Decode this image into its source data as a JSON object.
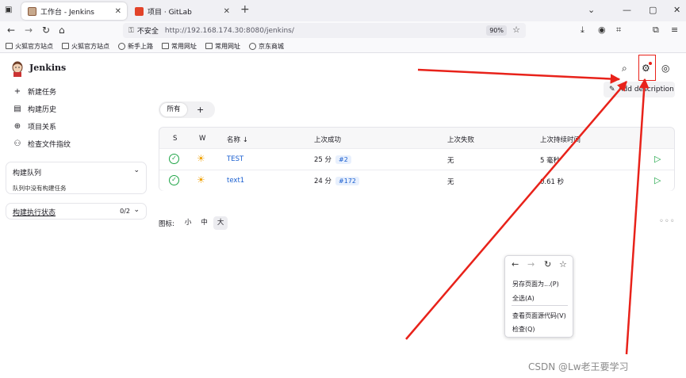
{
  "browser": {
    "tabs": [
      {
        "title": "工作台 - Jenkins",
        "active": true
      },
      {
        "title": "项目 · GitLab",
        "active": false
      }
    ],
    "url_security": "不安全",
    "url": "http://192.168.174.30:8080/jenkins/",
    "zoom": "90%",
    "bookmarks": [
      "火狐官方站点",
      "火狐官方站点",
      "新手上路",
      "常用网址",
      "常用网址",
      "京东商城"
    ]
  },
  "jenkins": {
    "brand": "Jenkins",
    "sidebar": {
      "items": [
        {
          "label": "新建任务",
          "icon": "plus-icon"
        },
        {
          "label": "构建历史",
          "icon": "history-icon"
        },
        {
          "label": "项目关系",
          "icon": "relationship-icon"
        },
        {
          "label": "检查文件指纹",
          "icon": "fingerprint-icon"
        }
      ],
      "build_queue": {
        "title": "构建队列",
        "empty_text": "队列中没有构建任务"
      },
      "executors": {
        "title": "构建执行状态",
        "count": "0/2"
      }
    },
    "add_description": "Add description",
    "view_tabs": {
      "all": "所有",
      "add": "+"
    },
    "table": {
      "headers": {
        "s": "S",
        "w": "W",
        "name": "名称 ↓",
        "last_success": "上次成功",
        "last_failure": "上次失败",
        "last_duration": "上次持续时间"
      },
      "rows": [
        {
          "name": "TEST",
          "last_success": "25 分",
          "build": "#2",
          "last_failure": "无",
          "last_duration": "5 毫秒"
        },
        {
          "name": "text1",
          "last_success": "24 分",
          "build": "#172",
          "last_failure": "无",
          "last_duration": "0.61 秒"
        }
      ]
    },
    "icon_size": {
      "label": "图标:",
      "options": [
        "小",
        "中",
        "大"
      ],
      "selected": "大"
    }
  },
  "context_menu": {
    "items": [
      "另存页面为...(P)",
      "全选(A)",
      "查看页面源代码(V)",
      "检查(Q)"
    ]
  },
  "watermark": "CSDN @Lw老王要学习",
  "colors": {
    "accent": "#1a5fd0",
    "success": "#1ea446",
    "highlight": "#e8221a",
    "weather": "#f0a30a"
  }
}
